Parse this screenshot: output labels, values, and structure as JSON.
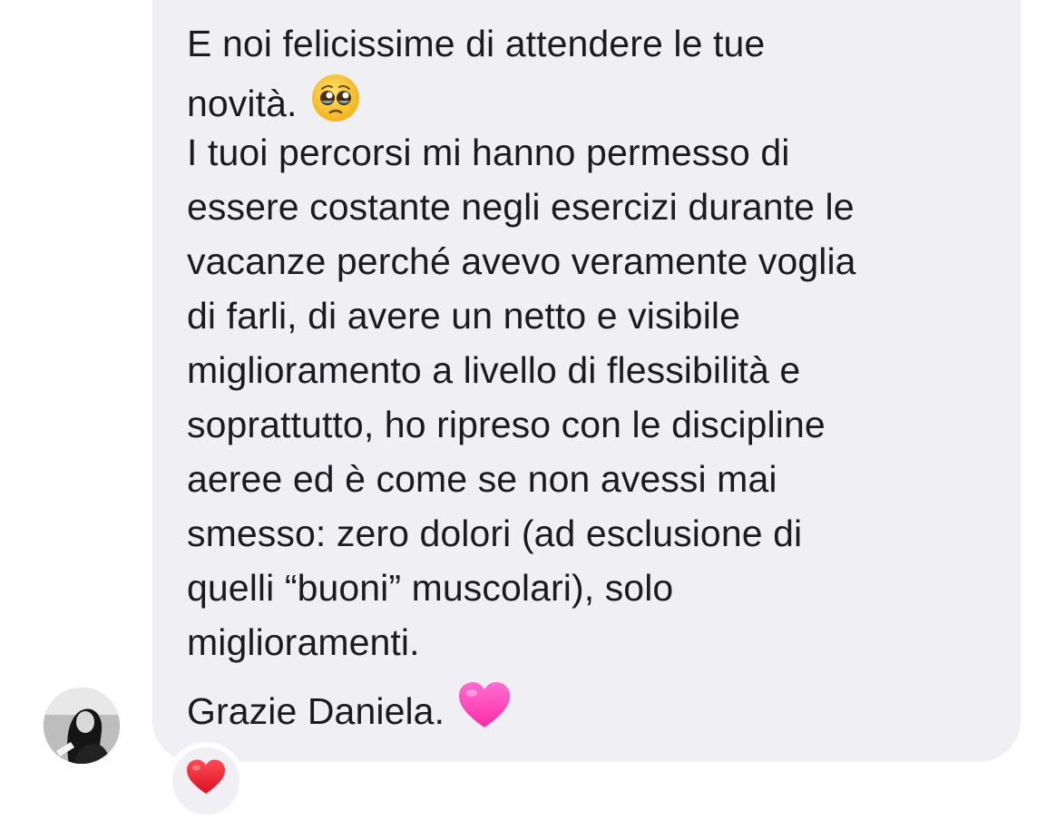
{
  "message": {
    "lines": [
      "E noi felicissime di attendere le tue",
      "novità.",
      "I tuoi percorsi mi hanno permesso di",
      "essere costante negli esercizi durante le",
      "vacanze perché avevo veramente voglia",
      "di farli, di avere un netto e visibile",
      "miglioramento a livello di flessibilità e",
      "soprattutto, ho ripreso con le discipline",
      "aeree ed è come se non avessi mai",
      "smesso: zero dolori (ad esclusione di",
      "quelli “buoni” muscolari), solo",
      "miglioramenti.",
      "Grazie Daniela."
    ],
    "emojis": [
      "pleading-face-icon",
      "pink-heart-icon"
    ]
  },
  "reaction": {
    "icon": "red-heart-icon"
  },
  "colors": {
    "bubble_bg": "#efeff4",
    "text": "#1c1c1e",
    "pink_heart": "#ff3fb4",
    "red_heart": "#e0212f"
  }
}
